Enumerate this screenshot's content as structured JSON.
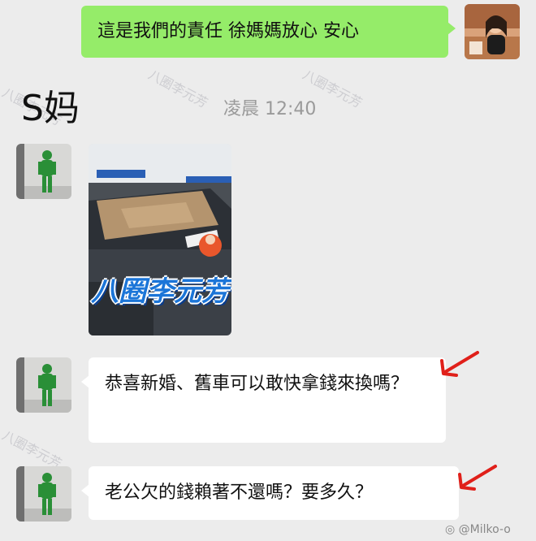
{
  "messages": {
    "outgoing_1": "這是我們的責任 徐媽媽放心 安心",
    "incoming_1": "恭喜新婚、舊車可以敢快拿錢來換嗎？",
    "incoming_2": "老公欠的錢賴著不還嗎？要多久？"
  },
  "sender_name": "S妈",
  "timestamp": "凌晨 12:40",
  "watermark": "八圈李元芳",
  "sticker_logo_text": "八圈李元芳",
  "footer_credit": "@Milko-o",
  "colors": {
    "background": "#ececec",
    "outgoing_bubble": "#95ec69",
    "incoming_bubble": "#ffffff",
    "arrow": "#e0201a",
    "logo_blue": "#1b75d8"
  }
}
